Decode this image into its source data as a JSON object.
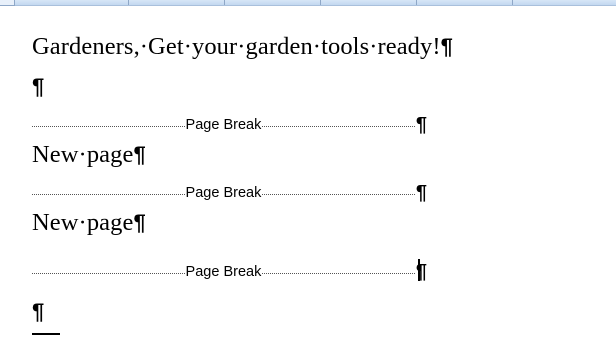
{
  "document": {
    "lines": [
      {
        "kind": "text",
        "text": "Gardeners,·Get·your·garden·tools·ready!",
        "mark": "¶"
      },
      {
        "kind": "empty",
        "mark": "¶"
      },
      {
        "kind": "page-break",
        "label": "Page Break",
        "mark": "¶"
      },
      {
        "kind": "text",
        "text": "New·page",
        "mark": "¶"
      },
      {
        "kind": "page-break",
        "label": "Page Break",
        "mark": "¶"
      },
      {
        "kind": "text",
        "text": "New·page",
        "mark": "¶"
      },
      {
        "kind": "page-break",
        "label": "Page Break",
        "mark": "¶"
      },
      {
        "kind": "empty",
        "mark": "¶"
      }
    ]
  },
  "colors": {
    "ruler": "#c3d8f0",
    "text": "#000000",
    "background": "#ffffff"
  }
}
